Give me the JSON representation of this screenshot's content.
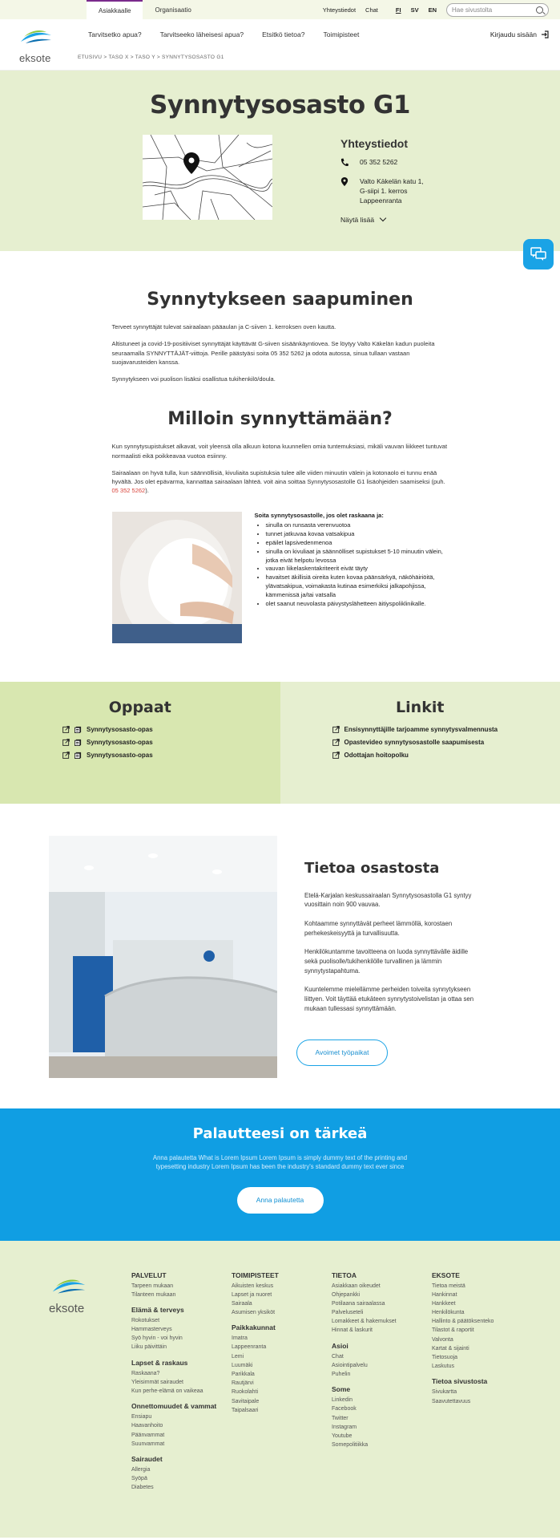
{
  "topbar": {
    "tabs": [
      "Asiakkaalle",
      "Organisaatio"
    ],
    "links": [
      "Yhteystiedot",
      "Chat"
    ],
    "languages": [
      "FI",
      "SV",
      "EN"
    ],
    "search_placeholder": "Hae sivustolta"
  },
  "header": {
    "logo_text": "eksote",
    "nav": [
      "Tarvitsetko apua?",
      "Tarvitseeko läheisesi apua?",
      "Etsitkö tietoa?",
      "Toimipisteet"
    ],
    "login": "Kirjaudu sisään",
    "breadcrumb": "ETUSIVU > TASO X > TASO Y > SYNNYTYSOSASTO G1"
  },
  "hero": {
    "title": "Synnytysosasto G1",
    "contact_title": "Yhteystiedot",
    "phone": "05 352 5262",
    "address": [
      "Valto Käkelän katu 1,",
      "G-siipi 1. kerros",
      "Lappeenranta"
    ],
    "show_more": "Näytä lisää"
  },
  "arrival": {
    "title": "Synnytykseen saapuminen",
    "paragraphs": [
      "Terveet synnyttäjät tulevat sairaalaan pääaulan ja C-siiven 1. kerroksen oven kautta.",
      "Altistuneet ja covid-19-positiiviset synnyttäjät käyttävät G-siiven sisäänkäyntiovea. Se löytyy Valto Käkelän kadun puoleita seuraamalla SYNNYTTÄJÄT-viittoja. Perille päästyäsi soita 05 352 5262 ja odota autossa, sinua tullaan vastaan suojavarusteiden kanssa.",
      "Synnytykseen voi puolison lisäksi osallistua tukihenkilö/doula."
    ]
  },
  "when": {
    "title": "Milloin synnyttämään?",
    "p1": "Kun synnytysupistukset alkavat, voit yleensä olla alkuun kotona kuunnellen omia tuntemuksiasi, mikäli vauvan liikkeet tuntuvat normaalisti eikä poikkeavaa vuotoa esiinny.",
    "p2_before": "Sairaalaan on hyvä tulla, kun säännöllisiä, kivuliaita supistuksia tulee alle viiden minuutin välein ja kotonaolo ei tunnu enää hyvältä. Jos olet epävarma, kannattaa sairaalaan lähteä. voit aina soittaa Synnytysosastolle G1 lisäohjeiden saamiseksi (puh. ",
    "p2_phone": "05 352 5262",
    "p2_after": ").",
    "list_title": "Soita synnytysosastolle, jos olet raskaana ja:",
    "list": [
      "sinulla on runsasta verenvuotoa",
      "tunnet jatkuvaa kovaa vatsakipua",
      "epäilet lapsivedenmenoa",
      "sinulla on kivuliaat ja säännölliset supistukset 5-10 minuutin välein, jotka eivät helpotu levossa",
      "vauvan liikelaskentakriteerit eivät täyty",
      "havaitset äkillisiä oireita kuten kovaa päänsärkyä, näköhäiriöitä, ylävatsakipua, voimakasta kutinaa esimerkiksi jalkapohjissa, kämmenissä ja/tai vatsalla",
      "olet saanut neuvolasta päivystyslähetteen äitiyspoliklinikalle."
    ]
  },
  "guides": {
    "title": "Oppaat",
    "items": [
      "Synnytysosasto-opas",
      "Synnytysosasto-opas",
      "Synnytysosasto-opas"
    ]
  },
  "links": {
    "title": "Linkit",
    "items": [
      "Ensisynnyttäjille tarjoamme synnytysvalmennusta",
      "Opastevideo synnytysosastolle saapumisesta",
      "Odottajan hoitopolku"
    ]
  },
  "about": {
    "title": "Tietoa osastosta",
    "paragraphs": [
      "Etelä-Karjalan keskussairaalan Synnytysosastolla G1 syntyy vuosittain noin 900 vauvaa.",
      "Kohtaamme synnyttävät perheet lämmöllä, korostaen perhekeskeisyyttä ja turvallisuutta.",
      "Henkilökuntamme tavoitteena on luoda synnyttävälle äidille sekä puolisolle/tukihenkilölle turvallinen ja lämmin synnytystapahtuma.",
      "Kuuntelemme mielellämme perheiden toiveita synnytykseen liittyen. Voit täyttää etukäteen synnytystoivelistan ja ottaa sen mukaan tullessasi synnyttämään."
    ],
    "button": "Avoimet työpaikat"
  },
  "feedback": {
    "title": "Palautteesi on tärkeä",
    "text": "Anna palautetta What is Lorem Ipsum Lorem Ipsum is simply dummy text of the printing and typesetting industry Lorem Ipsum has been the industry's standard dummy text ever since",
    "button": "Anna palautetta"
  },
  "footer": {
    "logo_text": "eksote",
    "columns": [
      {
        "groups": [
          {
            "title": "PALVELUT",
            "items": [
              "Tarpeen mukaan",
              "Tilanteen mukaan"
            ]
          },
          {
            "title": "Elämä & terveys",
            "items": [
              "Rokotukset",
              "Hammasterveys",
              "Syö hyvin - voi hyvin",
              "Liiku päivittäin"
            ]
          },
          {
            "title": "Lapset & raskaus",
            "items": [
              "Raskaana?",
              "Yleisimmät sairaudet",
              "Kun perhe-elämä on vaikeaa"
            ]
          },
          {
            "title": "Onnettomuudet & vammat",
            "items": [
              "Ensiapu",
              "Haavanhoito",
              "Päänvammat",
              "Suunvammat"
            ]
          },
          {
            "title": "Sairaudet",
            "items": [
              "Allergia",
              "Syöpä",
              "Diabetes"
            ]
          }
        ]
      },
      {
        "groups": [
          {
            "title": "TOIMIPISTEET",
            "items": [
              "Aikuisten keskus",
              "Lapset ja nuoret",
              "Sairaala",
              "Asumisen yksiköt"
            ]
          },
          {
            "title": "Paikkakunnat",
            "items": [
              "Imatra",
              "Lappeenranta",
              "Lemi",
              "Luumäki",
              "Parikkala",
              "Rautjärvi",
              "Ruokolahti",
              "Savitaipale",
              "Taipalsaari"
            ]
          }
        ]
      },
      {
        "groups": [
          {
            "title": "TIETOA",
            "items": [
              "Asiakkaan oikeudet",
              "Ohjepankki",
              "Potilaana sairaalassa",
              "Palveluseteli",
              "Lomakkeet & hakemukset",
              "Hinnat & laskurit"
            ]
          },
          {
            "title": "Asioi",
            "items": [
              "Chat",
              "Asiointipalvelu",
              "Puhelin"
            ]
          },
          {
            "title": "Some",
            "items": [
              "Linkedin",
              "Facebook",
              "Twitter",
              "Instagram",
              "Youtube",
              "Somepolitiikka"
            ]
          }
        ]
      },
      {
        "groups": [
          {
            "title": "EKSOTE",
            "items": [
              "Tietoa meistä",
              "Hankinnat",
              "Hankkeet",
              "Henkilökunta",
              "Hallinto & päätöksenteko",
              "Tilastot & raportit",
              "Valvonta",
              "Kartat & sijainti",
              "Tietosuoja",
              "Laskutus"
            ]
          },
          {
            "title": "Tietoa sivustosta",
            "items": [
              "Sivukartta",
              "Saavutettavuus"
            ]
          }
        ]
      }
    ]
  }
}
